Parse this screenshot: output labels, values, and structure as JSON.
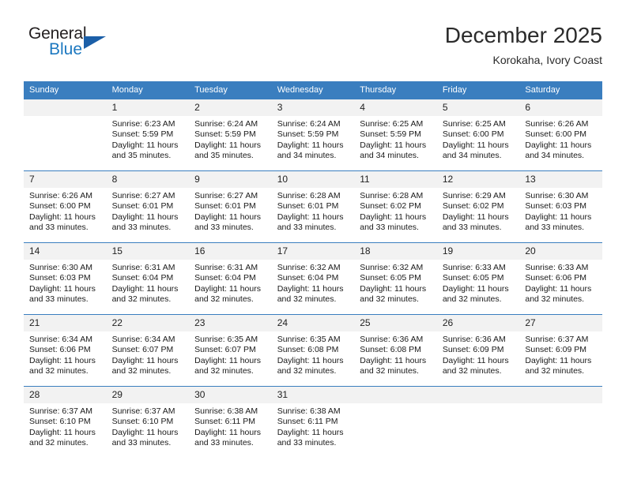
{
  "brand": {
    "name_part1": "General",
    "name_part2": "Blue",
    "flag_icon": "triangle-flag-icon"
  },
  "header": {
    "title": "December 2025",
    "subtitle": "Korokaha, Ivory Coast"
  },
  "calendar": {
    "weekday_headers": [
      "Sunday",
      "Monday",
      "Tuesday",
      "Wednesday",
      "Thursday",
      "Friday",
      "Saturday"
    ],
    "colors": {
      "header_bg": "#3a7ebf",
      "daynum_bg": "#f2f2f2",
      "brand_blue": "#1c78c0",
      "flag_blue": "#1b5fa8"
    },
    "weeks": [
      [
        {
          "day": "",
          "sunrise": "",
          "sunset": "",
          "daylight_line1": "",
          "daylight_line2": ""
        },
        {
          "day": "1",
          "sunrise": "Sunrise: 6:23 AM",
          "sunset": "Sunset: 5:59 PM",
          "daylight_line1": "Daylight: 11 hours",
          "daylight_line2": "and 35 minutes."
        },
        {
          "day": "2",
          "sunrise": "Sunrise: 6:24 AM",
          "sunset": "Sunset: 5:59 PM",
          "daylight_line1": "Daylight: 11 hours",
          "daylight_line2": "and 35 minutes."
        },
        {
          "day": "3",
          "sunrise": "Sunrise: 6:24 AM",
          "sunset": "Sunset: 5:59 PM",
          "daylight_line1": "Daylight: 11 hours",
          "daylight_line2": "and 34 minutes."
        },
        {
          "day": "4",
          "sunrise": "Sunrise: 6:25 AM",
          "sunset": "Sunset: 5:59 PM",
          "daylight_line1": "Daylight: 11 hours",
          "daylight_line2": "and 34 minutes."
        },
        {
          "day": "5",
          "sunrise": "Sunrise: 6:25 AM",
          "sunset": "Sunset: 6:00 PM",
          "daylight_line1": "Daylight: 11 hours",
          "daylight_line2": "and 34 minutes."
        },
        {
          "day": "6",
          "sunrise": "Sunrise: 6:26 AM",
          "sunset": "Sunset: 6:00 PM",
          "daylight_line1": "Daylight: 11 hours",
          "daylight_line2": "and 34 minutes."
        }
      ],
      [
        {
          "day": "7",
          "sunrise": "Sunrise: 6:26 AM",
          "sunset": "Sunset: 6:00 PM",
          "daylight_line1": "Daylight: 11 hours",
          "daylight_line2": "and 33 minutes."
        },
        {
          "day": "8",
          "sunrise": "Sunrise: 6:27 AM",
          "sunset": "Sunset: 6:01 PM",
          "daylight_line1": "Daylight: 11 hours",
          "daylight_line2": "and 33 minutes."
        },
        {
          "day": "9",
          "sunrise": "Sunrise: 6:27 AM",
          "sunset": "Sunset: 6:01 PM",
          "daylight_line1": "Daylight: 11 hours",
          "daylight_line2": "and 33 minutes."
        },
        {
          "day": "10",
          "sunrise": "Sunrise: 6:28 AM",
          "sunset": "Sunset: 6:01 PM",
          "daylight_line1": "Daylight: 11 hours",
          "daylight_line2": "and 33 minutes."
        },
        {
          "day": "11",
          "sunrise": "Sunrise: 6:28 AM",
          "sunset": "Sunset: 6:02 PM",
          "daylight_line1": "Daylight: 11 hours",
          "daylight_line2": "and 33 minutes."
        },
        {
          "day": "12",
          "sunrise": "Sunrise: 6:29 AM",
          "sunset": "Sunset: 6:02 PM",
          "daylight_line1": "Daylight: 11 hours",
          "daylight_line2": "and 33 minutes."
        },
        {
          "day": "13",
          "sunrise": "Sunrise: 6:30 AM",
          "sunset": "Sunset: 6:03 PM",
          "daylight_line1": "Daylight: 11 hours",
          "daylight_line2": "and 33 minutes."
        }
      ],
      [
        {
          "day": "14",
          "sunrise": "Sunrise: 6:30 AM",
          "sunset": "Sunset: 6:03 PM",
          "daylight_line1": "Daylight: 11 hours",
          "daylight_line2": "and 33 minutes."
        },
        {
          "day": "15",
          "sunrise": "Sunrise: 6:31 AM",
          "sunset": "Sunset: 6:04 PM",
          "daylight_line1": "Daylight: 11 hours",
          "daylight_line2": "and 32 minutes."
        },
        {
          "day": "16",
          "sunrise": "Sunrise: 6:31 AM",
          "sunset": "Sunset: 6:04 PM",
          "daylight_line1": "Daylight: 11 hours",
          "daylight_line2": "and 32 minutes."
        },
        {
          "day": "17",
          "sunrise": "Sunrise: 6:32 AM",
          "sunset": "Sunset: 6:04 PM",
          "daylight_line1": "Daylight: 11 hours",
          "daylight_line2": "and 32 minutes."
        },
        {
          "day": "18",
          "sunrise": "Sunrise: 6:32 AM",
          "sunset": "Sunset: 6:05 PM",
          "daylight_line1": "Daylight: 11 hours",
          "daylight_line2": "and 32 minutes."
        },
        {
          "day": "19",
          "sunrise": "Sunrise: 6:33 AM",
          "sunset": "Sunset: 6:05 PM",
          "daylight_line1": "Daylight: 11 hours",
          "daylight_line2": "and 32 minutes."
        },
        {
          "day": "20",
          "sunrise": "Sunrise: 6:33 AM",
          "sunset": "Sunset: 6:06 PM",
          "daylight_line1": "Daylight: 11 hours",
          "daylight_line2": "and 32 minutes."
        }
      ],
      [
        {
          "day": "21",
          "sunrise": "Sunrise: 6:34 AM",
          "sunset": "Sunset: 6:06 PM",
          "daylight_line1": "Daylight: 11 hours",
          "daylight_line2": "and 32 minutes."
        },
        {
          "day": "22",
          "sunrise": "Sunrise: 6:34 AM",
          "sunset": "Sunset: 6:07 PM",
          "daylight_line1": "Daylight: 11 hours",
          "daylight_line2": "and 32 minutes."
        },
        {
          "day": "23",
          "sunrise": "Sunrise: 6:35 AM",
          "sunset": "Sunset: 6:07 PM",
          "daylight_line1": "Daylight: 11 hours",
          "daylight_line2": "and 32 minutes."
        },
        {
          "day": "24",
          "sunrise": "Sunrise: 6:35 AM",
          "sunset": "Sunset: 6:08 PM",
          "daylight_line1": "Daylight: 11 hours",
          "daylight_line2": "and 32 minutes."
        },
        {
          "day": "25",
          "sunrise": "Sunrise: 6:36 AM",
          "sunset": "Sunset: 6:08 PM",
          "daylight_line1": "Daylight: 11 hours",
          "daylight_line2": "and 32 minutes."
        },
        {
          "day": "26",
          "sunrise": "Sunrise: 6:36 AM",
          "sunset": "Sunset: 6:09 PM",
          "daylight_line1": "Daylight: 11 hours",
          "daylight_line2": "and 32 minutes."
        },
        {
          "day": "27",
          "sunrise": "Sunrise: 6:37 AM",
          "sunset": "Sunset: 6:09 PM",
          "daylight_line1": "Daylight: 11 hours",
          "daylight_line2": "and 32 minutes."
        }
      ],
      [
        {
          "day": "28",
          "sunrise": "Sunrise: 6:37 AM",
          "sunset": "Sunset: 6:10 PM",
          "daylight_line1": "Daylight: 11 hours",
          "daylight_line2": "and 32 minutes."
        },
        {
          "day": "29",
          "sunrise": "Sunrise: 6:37 AM",
          "sunset": "Sunset: 6:10 PM",
          "daylight_line1": "Daylight: 11 hours",
          "daylight_line2": "and 33 minutes."
        },
        {
          "day": "30",
          "sunrise": "Sunrise: 6:38 AM",
          "sunset": "Sunset: 6:11 PM",
          "daylight_line1": "Daylight: 11 hours",
          "daylight_line2": "and 33 minutes."
        },
        {
          "day": "31",
          "sunrise": "Sunrise: 6:38 AM",
          "sunset": "Sunset: 6:11 PM",
          "daylight_line1": "Daylight: 11 hours",
          "daylight_line2": "and 33 minutes."
        },
        {
          "day": "",
          "sunrise": "",
          "sunset": "",
          "daylight_line1": "",
          "daylight_line2": ""
        },
        {
          "day": "",
          "sunrise": "",
          "sunset": "",
          "daylight_line1": "",
          "daylight_line2": ""
        },
        {
          "day": "",
          "sunrise": "",
          "sunset": "",
          "daylight_line1": "",
          "daylight_line2": ""
        }
      ]
    ]
  }
}
